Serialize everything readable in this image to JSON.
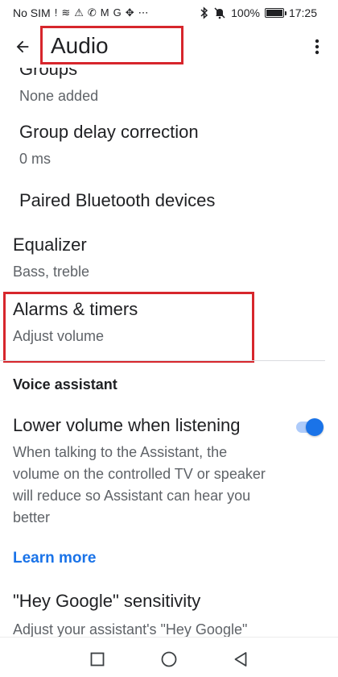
{
  "status_bar": {
    "carrier": "No SIM",
    "glyphs": [
      "!",
      "≋",
      "⚠",
      "✆",
      "M",
      "G",
      "✥",
      "⋯"
    ],
    "battery_percent": "100%",
    "battery_level": 1.0,
    "time": "17:25"
  },
  "app_bar": {
    "title": "Audio",
    "back_icon": "arrow-back-icon",
    "more_icon": "more-vert-icon"
  },
  "items": {
    "groups": {
      "title": "Groups",
      "subtitle": "None added"
    },
    "group_delay": {
      "title": "Group delay correction",
      "subtitle": "0 ms"
    },
    "paired_bt": {
      "title": "Paired Bluetooth devices"
    },
    "equalizer": {
      "title": "Equalizer",
      "subtitle": "Bass, treble"
    },
    "alarms": {
      "title": "Alarms & timers",
      "subtitle": "Adjust volume"
    }
  },
  "voice_assistant": {
    "header": "Voice assistant",
    "lower_volume": {
      "title": "Lower volume when listening",
      "description": "When talking to the Assistant, the volume on the controlled TV or speaker will reduce so Assistant can hear you better",
      "enabled": true
    },
    "learn_more": "Learn more",
    "hey_google": {
      "title": "\"Hey Google\" sensitivity",
      "subtitle": "Adjust your assistant's \"Hey Google\""
    }
  },
  "colors": {
    "accent": "#1a73e8",
    "highlight": "#d7262c",
    "text_primary": "#202124",
    "text_secondary": "#5f6368"
  },
  "nav_bar": {
    "icons": [
      "recents-square-icon",
      "home-circle-icon",
      "back-triangle-icon"
    ]
  }
}
